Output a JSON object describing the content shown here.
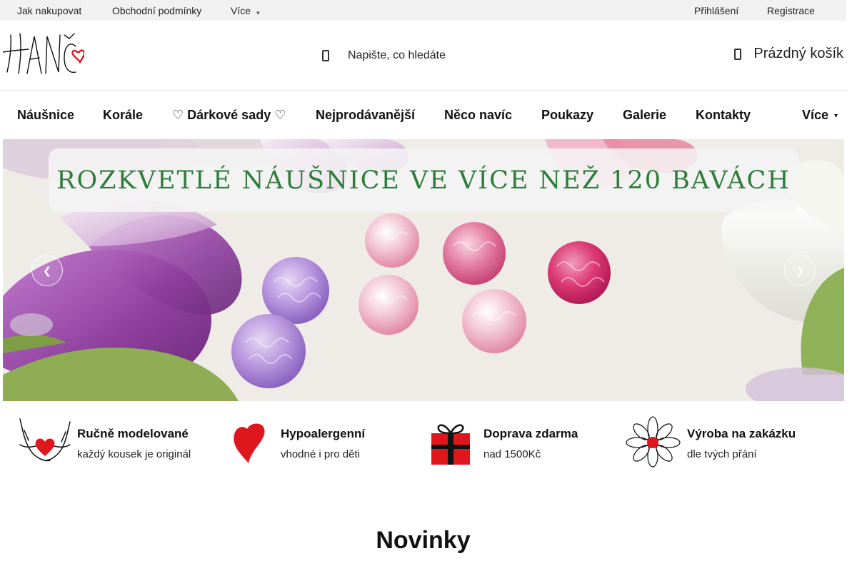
{
  "topbar": {
    "links": [
      "Jak nakupovat",
      "Obchodní podmínky",
      "Více"
    ],
    "account": [
      "Přihlášení",
      "Registrace"
    ]
  },
  "header": {
    "logo_text": "HANČ",
    "search_placeholder": "Napište, co hledáte",
    "cart_label": "Prázdný košík"
  },
  "nav": {
    "items": [
      "Náušnice",
      "Korále",
      "♡ Dárkové sady ♡",
      "Nejprodávanější",
      "Něco navíc",
      "Poukazy",
      "Galerie",
      "Kontakty"
    ],
    "more": "Více"
  },
  "hero": {
    "banner_text": "ROZKVETLÉ NÁUŠNICE VE VÍCE NEŽ 120 BAVÁCH",
    "prev_icon": "chevron-left-icon",
    "next_icon": "chevron-right-icon"
  },
  "features": [
    {
      "icon": "hands-heart-icon",
      "title": "Ručně modelované",
      "subtitle": "každý kousek je originál"
    },
    {
      "icon": "heart-icon",
      "title": "Hypoalergenní",
      "subtitle": "vhodné i pro děti"
    },
    {
      "icon": "gift-icon",
      "title": "Doprava zdarma",
      "subtitle": "nad 1500Kč"
    },
    {
      "icon": "flower-icon",
      "title": "Výroba na zakázku",
      "subtitle": "dle tvých přání"
    }
  ],
  "section": {
    "title": "Novinky"
  },
  "colors": {
    "accent_red": "#e0161d",
    "banner_green": "#2d7d3a",
    "topbar_bg": "#f1f1f1"
  }
}
